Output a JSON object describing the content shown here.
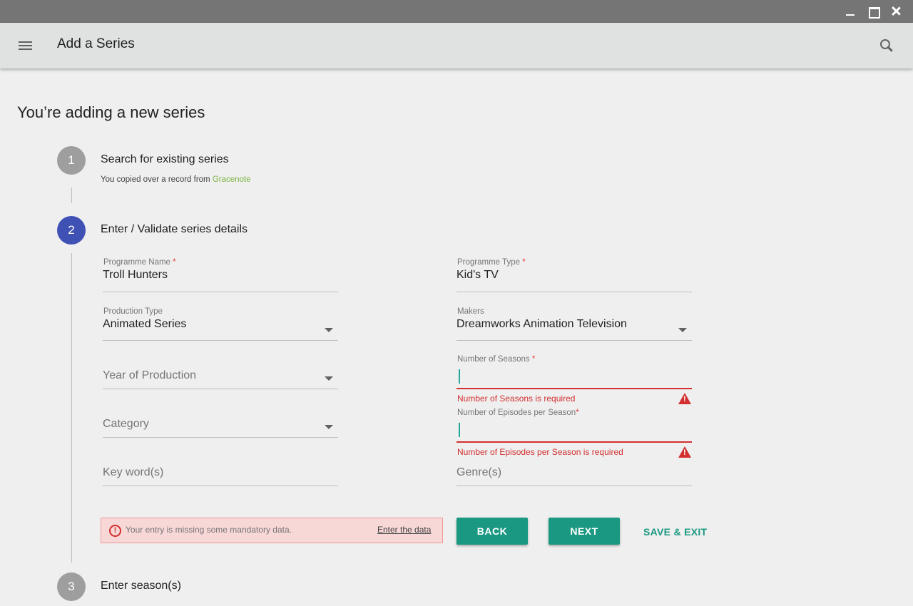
{
  "window": {},
  "appbar": {
    "title": "Add a Series"
  },
  "page": {
    "heading": "You’re adding a new series"
  },
  "steps": [
    {
      "number": "1",
      "title": "Search for existing series",
      "subtitle_prefix": "You copied over a record from ",
      "subtitle_link": "Gracenote"
    },
    {
      "number": "2",
      "title": "Enter / Validate series details"
    },
    {
      "number": "3",
      "title": "Enter season(s)"
    }
  ],
  "form": {
    "programme_name": {
      "label": "Programme Name",
      "required_mark": "*",
      "value": "Troll Hunters"
    },
    "programme_type": {
      "label": "Programme Type",
      "required_mark": "*",
      "value": "Kid's TV"
    },
    "production_type": {
      "label": "Production Type",
      "value": "Animated Series"
    },
    "makers": {
      "label": "Makers",
      "value": "Dreamworks Animation Television"
    },
    "year_of_production": {
      "placeholder": "Year of Production"
    },
    "number_of_seasons": {
      "label": "Number of Seasons",
      "required_mark": "*",
      "value": "",
      "error": "Number of Seasons is required"
    },
    "category": {
      "placeholder": "Category"
    },
    "episodes_per_season": {
      "label": "Number of Episodes per Season",
      "required_mark": "*",
      "value": "",
      "error": "Number of Episodes per Season is required"
    },
    "keywords": {
      "placeholder": "Key word(s)"
    },
    "genres": {
      "placeholder": "Genre(s)"
    }
  },
  "alert": {
    "message": "Your entry is missing some mandatory data.",
    "link": "Enter the data"
  },
  "actions": {
    "back": "BACK",
    "next": "NEXT",
    "save_exit": "SAVE & EXIT"
  },
  "colors": {
    "primary_teal": "#1a9882",
    "step_active": "#3f51b5",
    "step_done": "#9e9e9e",
    "error": "#d32f2f",
    "link_green": "#7cb342"
  }
}
